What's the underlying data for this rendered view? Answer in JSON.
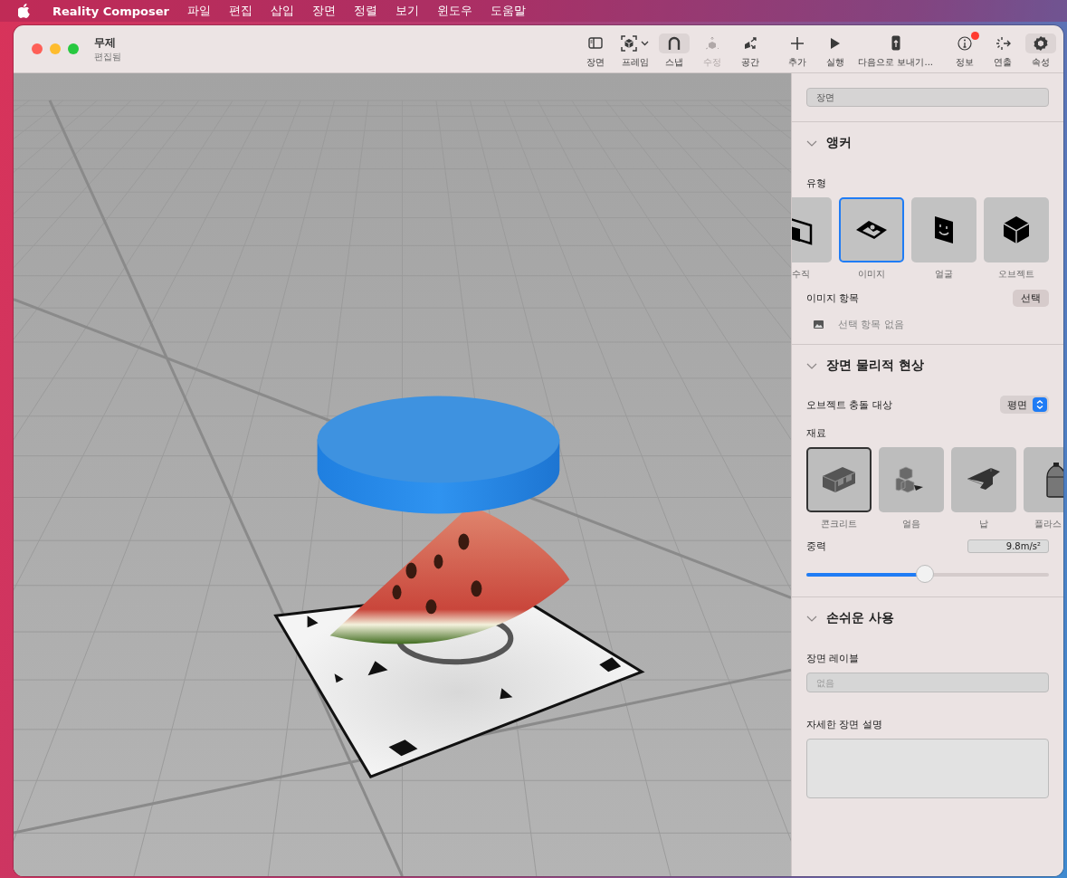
{
  "menu_bar": {
    "app_name": "Reality Composer",
    "items": [
      "파일",
      "편집",
      "삽입",
      "장면",
      "정렬",
      "보기",
      "윈도우",
      "도움말"
    ]
  },
  "window": {
    "title": "무제",
    "subtitle": "편집됨"
  },
  "toolbar": [
    {
      "kind": "scene",
      "label": "장면",
      "selected": false,
      "disabled": false,
      "badge": false
    },
    {
      "kind": "frame",
      "label": "프레임",
      "selected": false,
      "disabled": false,
      "badge": false
    },
    {
      "kind": "snap",
      "label": "스냅",
      "selected": true,
      "disabled": false,
      "badge": false
    },
    {
      "kind": "modify",
      "label": "수정",
      "selected": false,
      "disabled": true,
      "badge": false
    },
    {
      "kind": "space",
      "label": "공간",
      "selected": false,
      "disabled": false,
      "badge": false
    },
    {
      "kind": "add",
      "label": "추가",
      "selected": false,
      "disabled": false,
      "badge": false
    },
    {
      "kind": "play",
      "label": "실행",
      "selected": false,
      "disabled": false,
      "badge": false
    },
    {
      "kind": "send",
      "label": "다음으로 보내기...",
      "selected": false,
      "disabled": false,
      "badge": false
    },
    {
      "kind": "info",
      "label": "정보",
      "selected": false,
      "disabled": false,
      "badge": true
    },
    {
      "kind": "behaviors",
      "label": "연출",
      "selected": false,
      "disabled": false,
      "badge": false
    },
    {
      "kind": "properties",
      "label": "속성",
      "selected": true,
      "disabled": false,
      "badge": false
    }
  ],
  "inspector": {
    "scene_name": "장면",
    "anchor": {
      "title": "앵커",
      "expanded": true,
      "type_label": "유형",
      "types": [
        {
          "kind": "vertical",
          "label": "수직",
          "selected": false
        },
        {
          "kind": "image",
          "label": "이미지",
          "selected": true
        },
        {
          "kind": "face",
          "label": "얼굴",
          "selected": false
        },
        {
          "kind": "object",
          "label": "오브젝트",
          "selected": false
        }
      ],
      "image_label": "이미지 항목",
      "choose_button": "선택",
      "no_selection": "선택 항목 없음"
    },
    "physics": {
      "title": "장면 물리적 현상",
      "expanded": true,
      "collide_label": "오브젝트 충돌 대상",
      "collide_value": "평면",
      "material_label": "재료",
      "materials": [
        {
          "kind": "concrete",
          "label": "콘크리트",
          "selected": true
        },
        {
          "kind": "ice",
          "label": "얼음",
          "selected": false
        },
        {
          "kind": "lead",
          "label": "납",
          "selected": false
        },
        {
          "kind": "plastic",
          "label": "플라스",
          "selected": false
        }
      ],
      "gravity_label": "중력",
      "gravity_value": "9.8m/s²",
      "gravity": {
        "level": 0.49
      }
    },
    "accessibility": {
      "title": "손쉬운 사용",
      "expanded": true,
      "scene_label_label": "장면 레이블",
      "scene_label_placeholder": "없음",
      "description_label": "자세한 장면 설명"
    }
  }
}
